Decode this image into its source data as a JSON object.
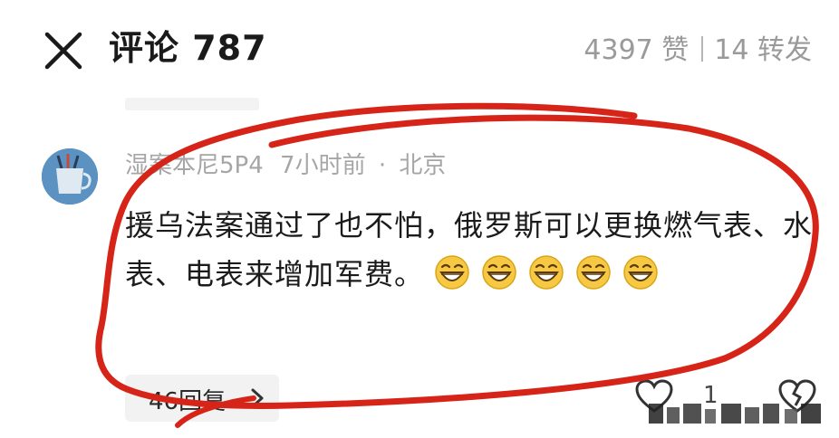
{
  "header": {
    "title": "评论 787",
    "likes": "4397 赞",
    "shares": "14 转发"
  },
  "comment": {
    "meta_user": "湿案本尼5P4",
    "meta_time": "7小时前",
    "meta_dot": "·",
    "meta_location": "北京",
    "text": "援乌法案通过了也不怕，俄罗斯可以更换燃气表、水表、电表来增加军费。",
    "emoji_count": 5,
    "reply_label": "46回复",
    "like_count": "1"
  },
  "colors": {
    "annotation": "#d62418",
    "avatar": "#5b92c2",
    "emoji": "#f6c843"
  },
  "icons": [
    "close-icon",
    "cup-icon",
    "grin-emoji-icon",
    "chevron-right-icon",
    "heart-icon",
    "broken-heart-icon"
  ]
}
